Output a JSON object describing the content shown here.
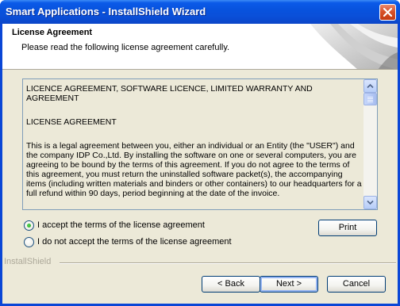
{
  "window": {
    "title": "Smart Applications - InstallShield Wizard"
  },
  "header": {
    "title": "License Agreement",
    "subtitle": "Please read the following license agreement carefully."
  },
  "license": {
    "paragraphs": [
      "LICENCE AGREEMENT, SOFTWARE LICENCE, LIMITED WARRANTY AND AGREEMENT",
      "LICENSE AGREEMENT",
      "This is a legal agreement between you, either an individual or an Entity (the \"USER\") and the company IDP Co.,Ltd. By installing the software on one or several computers, you are agreeing to be bound by the terms of this agreement. If you do not agree to the terms of this agreement, you must return the uninstalled software packet(s), the accompanying items (including written materials and binders or other containers) to our headquarters for a full refund within 90 days, period beginning at the date of the invoice."
    ]
  },
  "options": {
    "accept_label": "I accept the terms of the license agreement",
    "decline_label": "I do not accept the terms of the license agreement",
    "selected": "accept"
  },
  "buttons": {
    "print": "Print",
    "back": "< Back",
    "next": "Next >",
    "cancel": "Cancel"
  },
  "footer": {
    "brand": "InstallShield"
  },
  "colors": {
    "titlebar": "#0a4fd8",
    "dialog_face": "#ece9d8",
    "button_border": "#003c74",
    "radio_selected": "#21a121"
  },
  "icons": {
    "close": "close-icon",
    "scroll_up": "arrow-up-icon",
    "scroll_down": "arrow-down-icon",
    "header_art": "decorative-swirl-icon"
  }
}
